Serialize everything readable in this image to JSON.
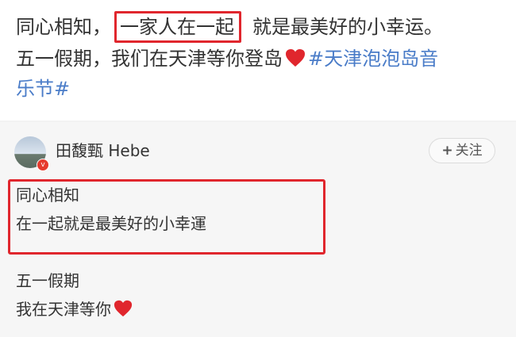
{
  "post": {
    "line1_a": "同心相知，",
    "line1_highlight": "一家人在一起",
    "line1_b": "就是最美好的小幸运。",
    "line2_a": "五一假期，我们在天津等你登岛",
    "line2_hashtag": "#天津泡泡岛音",
    "line3_hashtag": "乐节#"
  },
  "quoted": {
    "username": "田馥甄 Hebe",
    "follow_plus": "+",
    "follow_label": "关注",
    "verify_mark": "v",
    "line1": "同心相知",
    "line2": "在一起就是最美好的小幸運",
    "line3": "五一假期",
    "line4": "我在天津等你"
  },
  "colors": {
    "highlight_border": "#e0262d",
    "hashtag": "#4a7cc8",
    "heart": "#e0262d"
  }
}
